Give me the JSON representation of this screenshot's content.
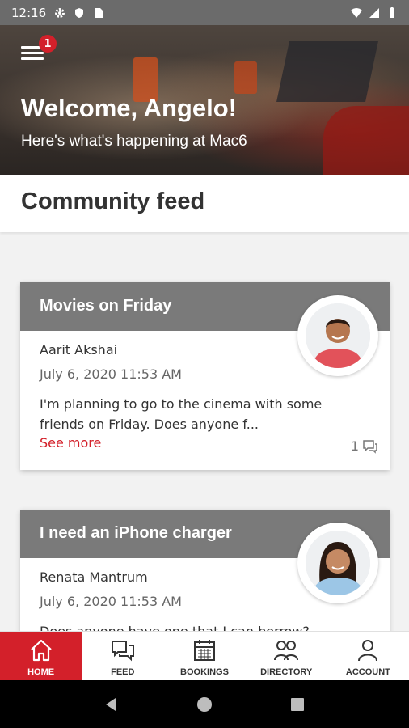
{
  "status_bar": {
    "time": "12:16"
  },
  "hero": {
    "menu_badge": "1",
    "title": "Welcome, Angelo!",
    "subtitle": "Here's what's happening at Mac6"
  },
  "section": {
    "title": "Community feed"
  },
  "posts": [
    {
      "title": "Movies on Friday",
      "author": "Aarit Akshai",
      "date": "July 6, 2020 11:53 AM",
      "body": "I'm planning to go to the cinema with some friends on Friday. Does anyone f...",
      "see_more": "See more",
      "comments": "1"
    },
    {
      "title": "I need an iPhone charger",
      "author": "Renata Mantrum",
      "date": "July 6, 2020 11:53 AM",
      "body": "Does anyone have one that I can borrow?"
    }
  ],
  "bottom_nav": [
    {
      "label": "HOME",
      "icon": "home-icon",
      "active": true
    },
    {
      "label": "FEED",
      "icon": "chat-icon"
    },
    {
      "label": "BOOKINGS",
      "icon": "calendar-icon"
    },
    {
      "label": "DIRECTORY",
      "icon": "people-icon"
    },
    {
      "label": "ACCOUNT",
      "icon": "person-icon"
    }
  ],
  "colors": {
    "accent": "#d3202a",
    "card_header": "#7a7a7a",
    "status_bar": "#6b6b6b"
  }
}
